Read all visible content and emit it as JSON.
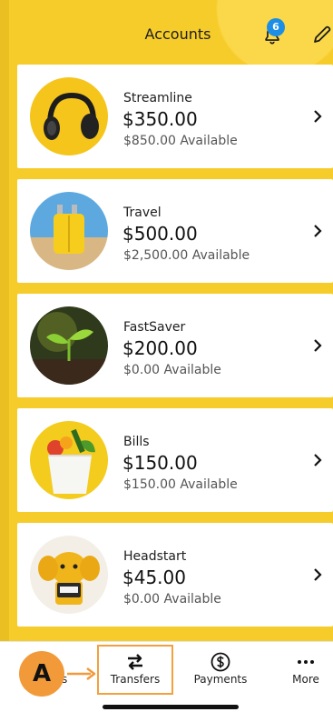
{
  "header": {
    "title": "Accounts",
    "notification_count": "6"
  },
  "accounts": [
    {
      "name": "Streamline",
      "balance": "$350.00",
      "available": "$850.00 Available",
      "image": "headphones-image"
    },
    {
      "name": "Travel",
      "balance": "$500.00",
      "available": "$2,500.00 Available",
      "image": "suitcase-image"
    },
    {
      "name": "FastSaver",
      "balance": "$200.00",
      "available": "$0.00 Available",
      "image": "sprout-image"
    },
    {
      "name": "Bills",
      "balance": "$150.00",
      "available": "$150.00 Available",
      "image": "grocery-bag-image"
    },
    {
      "name": "Headstart",
      "balance": "$45.00",
      "available": "$0.00 Available",
      "image": "elephant-image"
    }
  ],
  "tabbar": {
    "partial_label": "s",
    "transfers": "Transfers",
    "payments": "Payments",
    "more": "More"
  },
  "annotation": {
    "letter": "A"
  },
  "colors": {
    "brand_yellow": "#f6cc2a",
    "badge_blue": "#1c8ee6",
    "annotation_orange": "#f29a3a"
  }
}
